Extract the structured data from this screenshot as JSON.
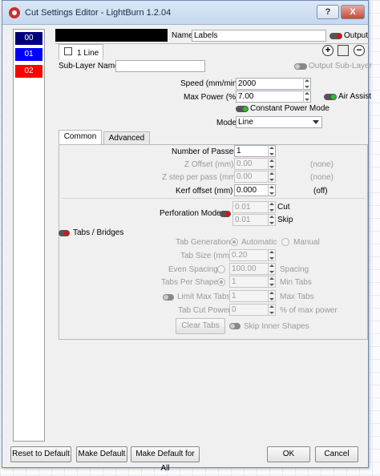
{
  "window": {
    "title": "Cut Settings Editor - LightBurn 1.2.04",
    "help_label": "?",
    "close_label": "X"
  },
  "layers": [
    {
      "label": "00",
      "color": "#00007a"
    },
    {
      "label": "01",
      "color": "#0000ff"
    },
    {
      "label": "02",
      "color": "#ff0000"
    }
  ],
  "header": {
    "name_label": "Name",
    "name_value": "Labels",
    "output_label": "Output"
  },
  "sublayer": {
    "tab_label": "1 Line",
    "name_label": "Sub-Layer Name",
    "name_value": "",
    "output_sublayer_label": "Output Sub-Layer"
  },
  "speed": {
    "label": "Speed (mm/min)",
    "value": "2000"
  },
  "power": {
    "label": "Max Power (%)",
    "value": "7.00"
  },
  "air_assist_label": "Air Assist",
  "constant_power_label": "Constant Power Mode",
  "mode": {
    "label": "Mode",
    "value": "Line"
  },
  "tabs": {
    "common": "Common",
    "advanced": "Advanced"
  },
  "passes": {
    "label": "Number of Passes",
    "value": "1"
  },
  "z_offset": {
    "label": "Z Offset (mm)",
    "value": "0.00",
    "note": "(none)"
  },
  "z_step": {
    "label": "Z step per pass (mm)",
    "value": "0.00",
    "note": "(none)"
  },
  "kerf": {
    "label": "Kerf offset (mm)",
    "value": "0.000",
    "note": "(off)"
  },
  "perforation": {
    "label": "Perforation Mode",
    "cut_value": "0.01",
    "cut_label": "Cut",
    "skip_value": "0.01",
    "skip_label": "Skip"
  },
  "bridges": {
    "label": "Tabs / Bridges",
    "generation_label": "Tab Generation",
    "automatic_label": "Automatic",
    "manual_label": "Manual",
    "size_label": "Tab Size (mm)",
    "size_value": "0.20",
    "even_spacing_label": "Even Spacing",
    "spacing_value": "100.00",
    "spacing_label": "Spacing",
    "per_shape_label": "Tabs Per Shape",
    "per_shape_value": "1",
    "min_tabs_label": "Min Tabs",
    "limit_max_label": "Limit Max Tabs",
    "max_value": "1",
    "max_tabs_label": "Max Tabs",
    "cut_power_label": "Tab Cut Power",
    "cut_power_value": "0",
    "pct_label": "% of max power",
    "clear_label": "Clear Tabs",
    "skip_inner_label": "Skip Inner Shapes"
  },
  "footer": {
    "reset": "Reset to Default",
    "make_default": "Make Default",
    "make_default_all": "Make Default for All",
    "ok": "OK",
    "cancel": "Cancel"
  }
}
